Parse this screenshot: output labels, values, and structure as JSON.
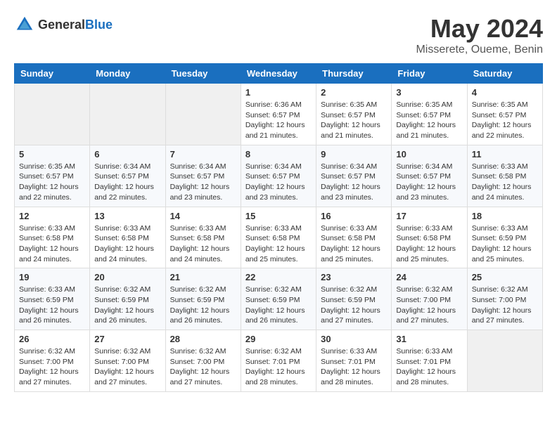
{
  "header": {
    "logo_general": "General",
    "logo_blue": "Blue",
    "month_year": "May 2024",
    "location": "Misserete, Oueme, Benin"
  },
  "days_of_week": [
    "Sunday",
    "Monday",
    "Tuesday",
    "Wednesday",
    "Thursday",
    "Friday",
    "Saturday"
  ],
  "weeks": [
    [
      {
        "day": "",
        "info": ""
      },
      {
        "day": "",
        "info": ""
      },
      {
        "day": "",
        "info": ""
      },
      {
        "day": "1",
        "info": "Sunrise: 6:36 AM\nSunset: 6:57 PM\nDaylight: 12 hours\nand 21 minutes."
      },
      {
        "day": "2",
        "info": "Sunrise: 6:35 AM\nSunset: 6:57 PM\nDaylight: 12 hours\nand 21 minutes."
      },
      {
        "day": "3",
        "info": "Sunrise: 6:35 AM\nSunset: 6:57 PM\nDaylight: 12 hours\nand 21 minutes."
      },
      {
        "day": "4",
        "info": "Sunrise: 6:35 AM\nSunset: 6:57 PM\nDaylight: 12 hours\nand 22 minutes."
      }
    ],
    [
      {
        "day": "5",
        "info": "Sunrise: 6:35 AM\nSunset: 6:57 PM\nDaylight: 12 hours\nand 22 minutes."
      },
      {
        "day": "6",
        "info": "Sunrise: 6:34 AM\nSunset: 6:57 PM\nDaylight: 12 hours\nand 22 minutes."
      },
      {
        "day": "7",
        "info": "Sunrise: 6:34 AM\nSunset: 6:57 PM\nDaylight: 12 hours\nand 23 minutes."
      },
      {
        "day": "8",
        "info": "Sunrise: 6:34 AM\nSunset: 6:57 PM\nDaylight: 12 hours\nand 23 minutes."
      },
      {
        "day": "9",
        "info": "Sunrise: 6:34 AM\nSunset: 6:57 PM\nDaylight: 12 hours\nand 23 minutes."
      },
      {
        "day": "10",
        "info": "Sunrise: 6:34 AM\nSunset: 6:57 PM\nDaylight: 12 hours\nand 23 minutes."
      },
      {
        "day": "11",
        "info": "Sunrise: 6:33 AM\nSunset: 6:58 PM\nDaylight: 12 hours\nand 24 minutes."
      }
    ],
    [
      {
        "day": "12",
        "info": "Sunrise: 6:33 AM\nSunset: 6:58 PM\nDaylight: 12 hours\nand 24 minutes."
      },
      {
        "day": "13",
        "info": "Sunrise: 6:33 AM\nSunset: 6:58 PM\nDaylight: 12 hours\nand 24 minutes."
      },
      {
        "day": "14",
        "info": "Sunrise: 6:33 AM\nSunset: 6:58 PM\nDaylight: 12 hours\nand 24 minutes."
      },
      {
        "day": "15",
        "info": "Sunrise: 6:33 AM\nSunset: 6:58 PM\nDaylight: 12 hours\nand 25 minutes."
      },
      {
        "day": "16",
        "info": "Sunrise: 6:33 AM\nSunset: 6:58 PM\nDaylight: 12 hours\nand 25 minutes."
      },
      {
        "day": "17",
        "info": "Sunrise: 6:33 AM\nSunset: 6:58 PM\nDaylight: 12 hours\nand 25 minutes."
      },
      {
        "day": "18",
        "info": "Sunrise: 6:33 AM\nSunset: 6:59 PM\nDaylight: 12 hours\nand 25 minutes."
      }
    ],
    [
      {
        "day": "19",
        "info": "Sunrise: 6:33 AM\nSunset: 6:59 PM\nDaylight: 12 hours\nand 26 minutes."
      },
      {
        "day": "20",
        "info": "Sunrise: 6:32 AM\nSunset: 6:59 PM\nDaylight: 12 hours\nand 26 minutes."
      },
      {
        "day": "21",
        "info": "Sunrise: 6:32 AM\nSunset: 6:59 PM\nDaylight: 12 hours\nand 26 minutes."
      },
      {
        "day": "22",
        "info": "Sunrise: 6:32 AM\nSunset: 6:59 PM\nDaylight: 12 hours\nand 26 minutes."
      },
      {
        "day": "23",
        "info": "Sunrise: 6:32 AM\nSunset: 6:59 PM\nDaylight: 12 hours\nand 27 minutes."
      },
      {
        "day": "24",
        "info": "Sunrise: 6:32 AM\nSunset: 7:00 PM\nDaylight: 12 hours\nand 27 minutes."
      },
      {
        "day": "25",
        "info": "Sunrise: 6:32 AM\nSunset: 7:00 PM\nDaylight: 12 hours\nand 27 minutes."
      }
    ],
    [
      {
        "day": "26",
        "info": "Sunrise: 6:32 AM\nSunset: 7:00 PM\nDaylight: 12 hours\nand 27 minutes."
      },
      {
        "day": "27",
        "info": "Sunrise: 6:32 AM\nSunset: 7:00 PM\nDaylight: 12 hours\nand 27 minutes."
      },
      {
        "day": "28",
        "info": "Sunrise: 6:32 AM\nSunset: 7:00 PM\nDaylight: 12 hours\nand 27 minutes."
      },
      {
        "day": "29",
        "info": "Sunrise: 6:32 AM\nSunset: 7:01 PM\nDaylight: 12 hours\nand 28 minutes."
      },
      {
        "day": "30",
        "info": "Sunrise: 6:33 AM\nSunset: 7:01 PM\nDaylight: 12 hours\nand 28 minutes."
      },
      {
        "day": "31",
        "info": "Sunrise: 6:33 AM\nSunset: 7:01 PM\nDaylight: 12 hours\nand 28 minutes."
      },
      {
        "day": "",
        "info": ""
      }
    ]
  ]
}
